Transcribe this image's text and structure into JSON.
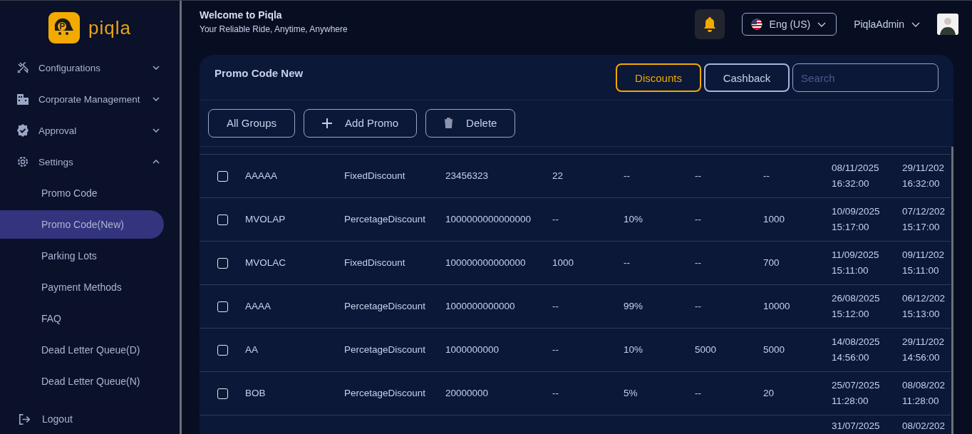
{
  "brand": {
    "name": "piqla"
  },
  "header": {
    "title": "Welcome to Piqla",
    "subtitle": "Your Reliable Ride, Anytime, Anywhere",
    "language": "Eng (US)",
    "user": "PiqlaAdmin"
  },
  "sidebar": {
    "items": [
      {
        "label": "Configurations",
        "expanded": false
      },
      {
        "label": "Corporate Management",
        "expanded": false
      },
      {
        "label": "Approval",
        "expanded": false
      },
      {
        "label": "Settings",
        "expanded": true,
        "children": [
          {
            "label": "Promo Code",
            "selected": false
          },
          {
            "label": "Promo Code(New)",
            "selected": true
          },
          {
            "label": "Parking Lots",
            "selected": false
          },
          {
            "label": "Payment Methods",
            "selected": false
          },
          {
            "label": "FAQ",
            "selected": false
          },
          {
            "label": "Dead Letter Queue(D)",
            "selected": false
          },
          {
            "label": "Dead Letter Queue(N)",
            "selected": false
          }
        ]
      }
    ],
    "logout": "Logout"
  },
  "card": {
    "title": "Promo Code New",
    "tabs": [
      {
        "label": "Discounts",
        "selected": true
      },
      {
        "label": "Cashback",
        "selected": false
      }
    ],
    "search": {
      "placeholder": "Search"
    },
    "actions": [
      {
        "label": "All Groups"
      },
      {
        "label": "Add Promo"
      },
      {
        "label": "Delete"
      }
    ]
  },
  "table": {
    "rows": [
      {
        "checked": false,
        "cells": [
          "AAAAA",
          "FixedDiscount",
          "23456323",
          "22",
          "--",
          "--",
          "--"
        ],
        "start": [
          "08/11/2025",
          "16:32:00"
        ],
        "end": [
          "29/11/202",
          "16:32:00"
        ]
      },
      {
        "checked": false,
        "cells": [
          "MVOLAP",
          "PercetageDiscount",
          "1000000000000000",
          "--",
          "10%",
          "--",
          "1000"
        ],
        "start": [
          "10/09/2025",
          "15:17:00"
        ],
        "end": [
          "07/12/202",
          "15:17:00"
        ]
      },
      {
        "checked": false,
        "cells": [
          "MVOLAC",
          "FixedDiscount",
          "100000000000000",
          "1000",
          "--",
          "--",
          "700"
        ],
        "start": [
          "11/09/2025",
          "15:11:00"
        ],
        "end": [
          "09/11/202",
          "15:11:00"
        ]
      },
      {
        "checked": false,
        "cells": [
          "AAAA",
          "PercetageDiscount",
          "1000000000000",
          "--",
          "99%",
          "--",
          "10000"
        ],
        "start": [
          "26/08/2025",
          "15:12:00"
        ],
        "end": [
          "06/12/202",
          "15:13:00"
        ]
      },
      {
        "checked": false,
        "cells": [
          "AA",
          "PercetageDiscount",
          "1000000000",
          "--",
          "10%",
          "5000",
          "5000"
        ],
        "start": [
          "14/08/2025",
          "14:56:00"
        ],
        "end": [
          "29/11/202",
          "14:56:00"
        ]
      },
      {
        "checked": false,
        "cells": [
          "BOB",
          "PercetageDiscount",
          "20000000",
          "--",
          "5%",
          "--",
          "20"
        ],
        "start": [
          "25/07/2025",
          "11:28:00"
        ],
        "end": [
          "08/08/202",
          "11:28:00"
        ]
      },
      {
        "start": [
          "31/07/2025"
        ],
        "end": [
          "08/02/202"
        ]
      }
    ]
  }
}
